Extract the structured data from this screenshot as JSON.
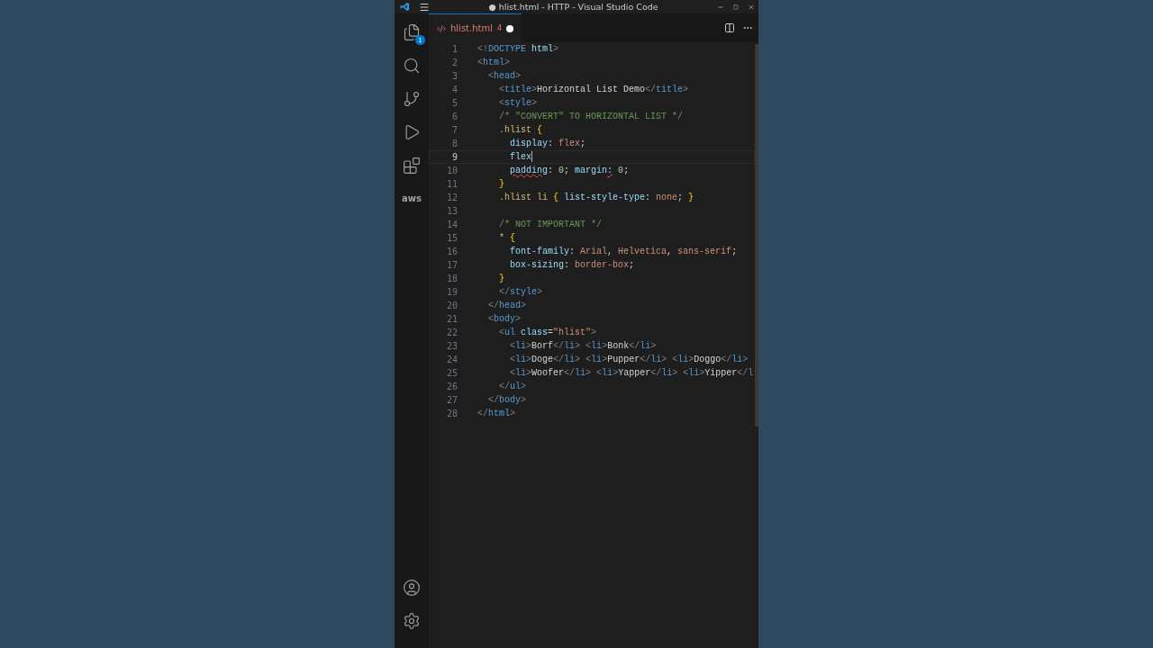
{
  "window": {
    "title": "● hlist.html - HTTP - Visual Studio Code"
  },
  "activity_bar": {
    "items": [
      {
        "kind": "files",
        "badge": "1",
        "selected": false
      },
      {
        "kind": "search",
        "selected": false
      },
      {
        "kind": "source-control",
        "selected": false
      },
      {
        "kind": "run",
        "selected": false
      },
      {
        "kind": "extensions",
        "selected": false
      },
      {
        "kind": "aws",
        "label": "aws",
        "selected": false
      }
    ],
    "bottom": [
      {
        "kind": "account"
      },
      {
        "kind": "settings"
      }
    ]
  },
  "tabs": [
    {
      "label": "hlist.html",
      "problems": "4",
      "modified": true,
      "selected": true
    }
  ],
  "editor": {
    "lines": [
      {
        "number": "1",
        "current": false,
        "tokens": [
          {
            "text": "<!",
            "kind": "punct"
          },
          {
            "text": "DOCTYPE",
            "kind": "tag"
          },
          {
            "text": " html",
            "kind": "attr"
          },
          {
            "text": ">",
            "kind": "punct"
          }
        ]
      },
      {
        "number": "2",
        "current": false,
        "tokens": [
          {
            "text": "<",
            "kind": "punct"
          },
          {
            "text": "html",
            "kind": "tag"
          },
          {
            "text": ">",
            "kind": "punct"
          }
        ]
      },
      {
        "number": "3",
        "current": false,
        "tokens": [
          {
            "text": "  <",
            "kind": "punct"
          },
          {
            "text": "head",
            "kind": "tag"
          },
          {
            "text": ">",
            "kind": "punct"
          }
        ]
      },
      {
        "number": "4",
        "current": false,
        "tokens": [
          {
            "text": "    <",
            "kind": "punct"
          },
          {
            "text": "title",
            "kind": "tag"
          },
          {
            "text": ">",
            "kind": "punct"
          },
          {
            "text": "Horizontal List Demo",
            "kind": "text"
          },
          {
            "text": "</",
            "kind": "punct"
          },
          {
            "text": "title",
            "kind": "tag"
          },
          {
            "text": ">",
            "kind": "punct"
          }
        ]
      },
      {
        "number": "5",
        "current": false,
        "tokens": [
          {
            "text": "    <",
            "kind": "punct"
          },
          {
            "text": "style",
            "kind": "tag"
          },
          {
            "text": ">",
            "kind": "punct"
          }
        ]
      },
      {
        "number": "6",
        "current": false,
        "tokens": [
          {
            "text": "    /* \"CONVERT\" TO HORIZONTAL LIST */",
            "kind": "comment"
          }
        ]
      },
      {
        "number": "7",
        "current": false,
        "tokens": [
          {
            "text": "    .hlist ",
            "kind": "selector"
          },
          {
            "text": "{",
            "kind": "brace"
          }
        ]
      },
      {
        "number": "8",
        "current": false,
        "tokens": [
          {
            "text": "      display",
            "kind": "prop"
          },
          {
            "text": ": ",
            "kind": "text"
          },
          {
            "text": "flex",
            "kind": "value"
          },
          {
            "text": ";",
            "kind": "text"
          }
        ]
      },
      {
        "number": "9",
        "current": true,
        "tokens": [
          {
            "text": "      flex",
            "kind": "prop"
          }
        ]
      },
      {
        "number": "10",
        "current": false,
        "tokens": [
          {
            "text": "      padding",
            "kind": "prop",
            "error": true
          },
          {
            "text": ": ",
            "kind": "text"
          },
          {
            "text": "0",
            "kind": "number"
          },
          {
            "text": "; ",
            "kind": "text"
          },
          {
            "text": "margin",
            "kind": "prop"
          },
          {
            "text": ":",
            "kind": "text",
            "error": true
          },
          {
            "text": " 0",
            "kind": "number"
          },
          {
            "text": ";",
            "kind": "text"
          }
        ]
      },
      {
        "number": "11",
        "current": false,
        "tokens": [
          {
            "text": "    }",
            "kind": "brace"
          }
        ]
      },
      {
        "number": "12",
        "current": false,
        "tokens": [
          {
            "text": "    .hlist li ",
            "kind": "selector"
          },
          {
            "text": "{",
            "kind": "brace"
          },
          {
            "text": " list-style-type",
            "kind": "prop"
          },
          {
            "text": ": ",
            "kind": "text"
          },
          {
            "text": "none",
            "kind": "value"
          },
          {
            "text": "; ",
            "kind": "text"
          },
          {
            "text": "}",
            "kind": "brace"
          }
        ]
      },
      {
        "number": "13",
        "current": false
      },
      {
        "number": "14",
        "current": false,
        "tokens": [
          {
            "text": "    /* NOT IMPORTANT */",
            "kind": "comment"
          }
        ]
      },
      {
        "number": "15",
        "current": false,
        "tokens": [
          {
            "text": "    * ",
            "kind": "selector"
          },
          {
            "text": "{",
            "kind": "brace"
          }
        ]
      },
      {
        "number": "16",
        "current": false,
        "tokens": [
          {
            "text": "      font-family",
            "kind": "prop"
          },
          {
            "text": ": ",
            "kind": "text"
          },
          {
            "text": "Arial",
            "kind": "value"
          },
          {
            "text": ", ",
            "kind": "text"
          },
          {
            "text": "Helvetica",
            "kind": "value"
          },
          {
            "text": ", ",
            "kind": "text"
          },
          {
            "text": "sans-serif",
            "kind": "value"
          },
          {
            "text": ";",
            "kind": "text"
          }
        ]
      },
      {
        "number": "17",
        "current": false,
        "tokens": [
          {
            "text": "      box-sizing",
            "kind": "prop"
          },
          {
            "text": ": ",
            "kind": "text"
          },
          {
            "text": "border-box",
            "kind": "value"
          },
          {
            "text": ";",
            "kind": "text"
          }
        ]
      },
      {
        "number": "18",
        "current": false,
        "tokens": [
          {
            "text": "    }",
            "kind": "brace"
          }
        ]
      },
      {
        "number": "19",
        "current": false,
        "tokens": [
          {
            "text": "    </",
            "kind": "punct"
          },
          {
            "text": "style",
            "kind": "tag"
          },
          {
            "text": ">",
            "kind": "punct"
          }
        ]
      },
      {
        "number": "20",
        "current": false,
        "tokens": [
          {
            "text": "  </",
            "kind": "punct"
          },
          {
            "text": "head",
            "kind": "tag"
          },
          {
            "text": ">",
            "kind": "punct"
          }
        ]
      },
      {
        "number": "21",
        "current": false,
        "tokens": [
          {
            "text": "  <",
            "kind": "punct"
          },
          {
            "text": "body",
            "kind": "tag"
          },
          {
            "text": ">",
            "kind": "punct"
          }
        ]
      },
      {
        "number": "22",
        "current": false,
        "tokens": [
          {
            "text": "    <",
            "kind": "punct"
          },
          {
            "text": "ul",
            "kind": "tag"
          },
          {
            "text": " class",
            "kind": "attr"
          },
          {
            "text": "=",
            "kind": "text"
          },
          {
            "text": "\"hlist\"",
            "kind": "string"
          },
          {
            "text": ">",
            "kind": "punct"
          }
        ]
      },
      {
        "number": "23",
        "current": false,
        "tokens": [
          {
            "text": "      <",
            "kind": "punct"
          },
          {
            "text": "li",
            "kind": "tag"
          },
          {
            "text": ">",
            "kind": "punct"
          },
          {
            "text": "Borf",
            "kind": "text"
          },
          {
            "text": "</",
            "kind": "punct"
          },
          {
            "text": "li",
            "kind": "tag"
          },
          {
            "text": "> <",
            "kind": "punct"
          },
          {
            "text": "li",
            "kind": "tag"
          },
          {
            "text": ">",
            "kind": "punct"
          },
          {
            "text": "Bonk",
            "kind": "text"
          },
          {
            "text": "</",
            "kind": "punct"
          },
          {
            "text": "li",
            "kind": "tag"
          },
          {
            "text": ">",
            "kind": "punct"
          }
        ]
      },
      {
        "number": "24",
        "current": false,
        "tokens": [
          {
            "text": "      <",
            "kind": "punct"
          },
          {
            "text": "li",
            "kind": "tag"
          },
          {
            "text": ">",
            "kind": "punct"
          },
          {
            "text": "Doge",
            "kind": "text"
          },
          {
            "text": "</",
            "kind": "punct"
          },
          {
            "text": "li",
            "kind": "tag"
          },
          {
            "text": "> <",
            "kind": "punct"
          },
          {
            "text": "li",
            "kind": "tag"
          },
          {
            "text": ">",
            "kind": "punct"
          },
          {
            "text": "Pupper",
            "kind": "text"
          },
          {
            "text": "</",
            "kind": "punct"
          },
          {
            "text": "li",
            "kind": "tag"
          },
          {
            "text": "> <",
            "kind": "punct"
          },
          {
            "text": "li",
            "kind": "tag"
          },
          {
            "text": ">",
            "kind": "punct"
          },
          {
            "text": "Doggo",
            "kind": "text"
          },
          {
            "text": "</",
            "kind": "punct"
          },
          {
            "text": "li",
            "kind": "tag"
          },
          {
            "text": ">",
            "kind": "punct"
          }
        ]
      },
      {
        "number": "25",
        "current": false,
        "tokens": [
          {
            "text": "      <",
            "kind": "punct"
          },
          {
            "text": "li",
            "kind": "tag"
          },
          {
            "text": ">",
            "kind": "punct"
          },
          {
            "text": "Woofer",
            "kind": "text"
          },
          {
            "text": "</",
            "kind": "punct"
          },
          {
            "text": "li",
            "kind": "tag"
          },
          {
            "text": "> <",
            "kind": "punct"
          },
          {
            "text": "li",
            "kind": "tag"
          },
          {
            "text": ">",
            "kind": "punct"
          },
          {
            "text": "Yapper",
            "kind": "text"
          },
          {
            "text": "</",
            "kind": "punct"
          },
          {
            "text": "li",
            "kind": "tag"
          },
          {
            "text": "> <",
            "kind": "punct"
          },
          {
            "text": "li",
            "kind": "tag"
          },
          {
            "text": ">",
            "kind": "punct"
          },
          {
            "text": "Yipper",
            "kind": "text"
          },
          {
            "text": "</l",
            "kind": "punct"
          }
        ]
      },
      {
        "number": "26",
        "current": false,
        "tokens": [
          {
            "text": "    </",
            "kind": "punct"
          },
          {
            "text": "ul",
            "kind": "tag"
          },
          {
            "text": ">",
            "kind": "punct"
          }
        ]
      },
      {
        "number": "27",
        "current": false,
        "tokens": [
          {
            "text": "  </",
            "kind": "punct"
          },
          {
            "text": "body",
            "kind": "tag"
          },
          {
            "text": ">",
            "kind": "punct"
          }
        ]
      },
      {
        "number": "28",
        "current": false,
        "tokens": [
          {
            "text": "</",
            "kind": "punct"
          },
          {
            "text": "html",
            "kind": "tag"
          },
          {
            "text": ">",
            "kind": "punct"
          }
        ]
      }
    ]
  }
}
